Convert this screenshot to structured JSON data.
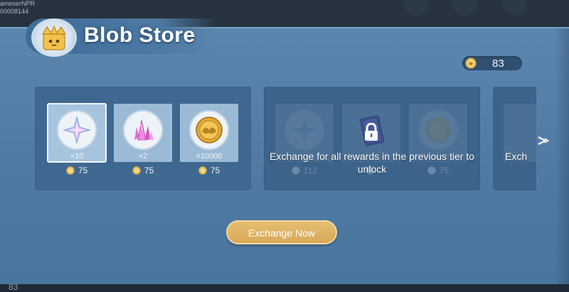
{
  "background": {
    "top_left_line1": "ameserNPR",
    "top_left_line2": "00008144",
    "bottom_left_value": "83"
  },
  "header": {
    "title": "Blob Store",
    "title_icon": "crown-box-icon"
  },
  "currency": {
    "amount": "83",
    "icon": "blob-coin-icon"
  },
  "tiers": [
    {
      "locked": false,
      "items": [
        {
          "icon": "star-crystal-icon",
          "quantity": "×10",
          "price": "75",
          "selected": true
        },
        {
          "icon": "pink-crystal-icon",
          "quantity": "×2",
          "price": "75",
          "selected": false
        },
        {
          "icon": "gold-coin-icon",
          "quantity": "×10000",
          "price": "75",
          "selected": false
        }
      ]
    },
    {
      "locked": true,
      "lock_message": "Exchange for all rewards in the previous tier to unlock",
      "items": [
        {
          "icon": "star-crystal-icon",
          "price": "112"
        },
        {
          "icon": "purple-card-icon",
          "price": ""
        },
        {
          "icon": "gold-coin-icon",
          "price": "75"
        }
      ]
    },
    {
      "locked": true,
      "lock_message": "Exch"
    }
  ],
  "actions": {
    "exchange_label": "Exchange Now"
  },
  "colors": {
    "panel": "#5b86ad",
    "tier_bg": "#3f6890",
    "button_gold": "#dcae5d",
    "coin_gold": "#e7b94c"
  }
}
